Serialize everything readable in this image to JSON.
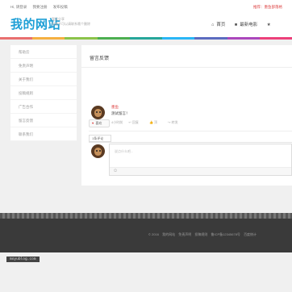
{
  "header": {
    "top_links": [
      "Hi, 请登录",
      "我要注册",
      "发布投稿"
    ],
    "recommend": "推荐：墨鱼部落格",
    "logo": "我的网站",
    "slogan_line1": "我爱分享",
    "slogan_line2": "如果不可以请联系哦个删除",
    "nav": [
      {
        "icon": "home-icon",
        "glyph": "⌂",
        "label": "首页"
      },
      {
        "icon": "video-camera-icon",
        "glyph": "■",
        "label": "最新电影"
      },
      {
        "icon": "star-icon",
        "glyph": "★",
        "label": ""
      }
    ]
  },
  "rainbow_colors": [
    "#e96f6f",
    "#f5b041",
    "#8bc34a",
    "#4caf50",
    "#26a69a",
    "#29b6f6",
    "#5c6bc0",
    "#ab47bc",
    "#ec407a"
  ],
  "sidebar": {
    "items": [
      "帮助云",
      "免责声明",
      "关于我们",
      "投稿规则",
      "广告合作",
      "留言反馈",
      "联系我们"
    ]
  },
  "main": {
    "title": "留言反馈",
    "like_label": "喜欢",
    "comment_count": "1条评论",
    "comment": {
      "author": "墨鱼",
      "text": "测试留言！",
      "meta": [
        "4小时前",
        "回复",
        "顶",
        "转发"
      ]
    },
    "reply_placeholder": "说点什么吧..."
  },
  "footer": {
    "text": [
      "© 2016",
      "我的网站",
      "免责声明",
      "投稿规则",
      "鲁ICP备12345678号",
      "百度统计"
    ]
  },
  "watermark": "moyublog.com"
}
